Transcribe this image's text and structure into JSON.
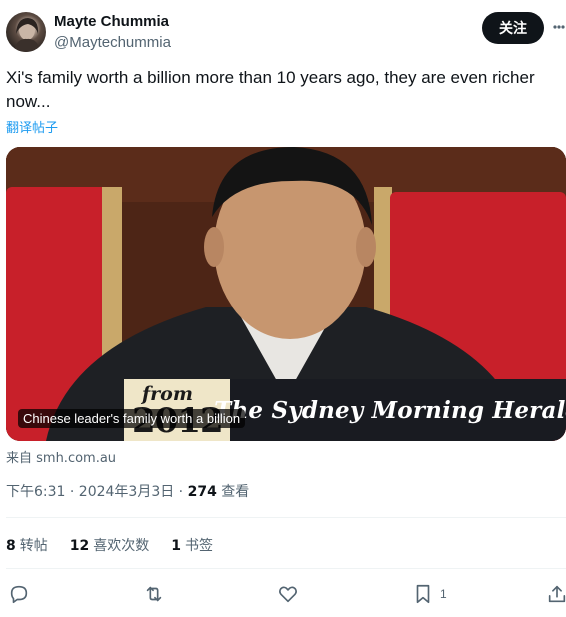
{
  "author": {
    "name": "Mayte Chummia",
    "handle": "@Maytechummia"
  },
  "follow_label": "关注",
  "tweet": {
    "text": "Xi's family worth a billion more than 10 years ago, they are even richer now...",
    "translate_label": "翻译帖子"
  },
  "card": {
    "banner_from": "from",
    "banner_year": "2012",
    "banner_masthead": "The Sydney Morning Herald",
    "caption": "Chinese leader's family worth a billion",
    "source": "来自 smh.com.au"
  },
  "meta": {
    "time_date": "下午6:31 · 2024年3月3日 · ",
    "views_count": "274",
    "views_label": " 查看"
  },
  "stats": {
    "reposts_count": "8",
    "reposts_label": "转帖",
    "likes_count": "12",
    "likes_label": "喜欢次数",
    "bookmarks_count": "1",
    "bookmarks_label": "书签"
  },
  "actions": {
    "bookmark_count": "1"
  },
  "icons": [
    "more-icon",
    "reply-icon",
    "repost-icon",
    "like-icon",
    "bookmark-icon",
    "share-icon"
  ],
  "colors": {
    "accent": "#1d9bf0",
    "text": "#0f1419",
    "muted": "#536471"
  }
}
